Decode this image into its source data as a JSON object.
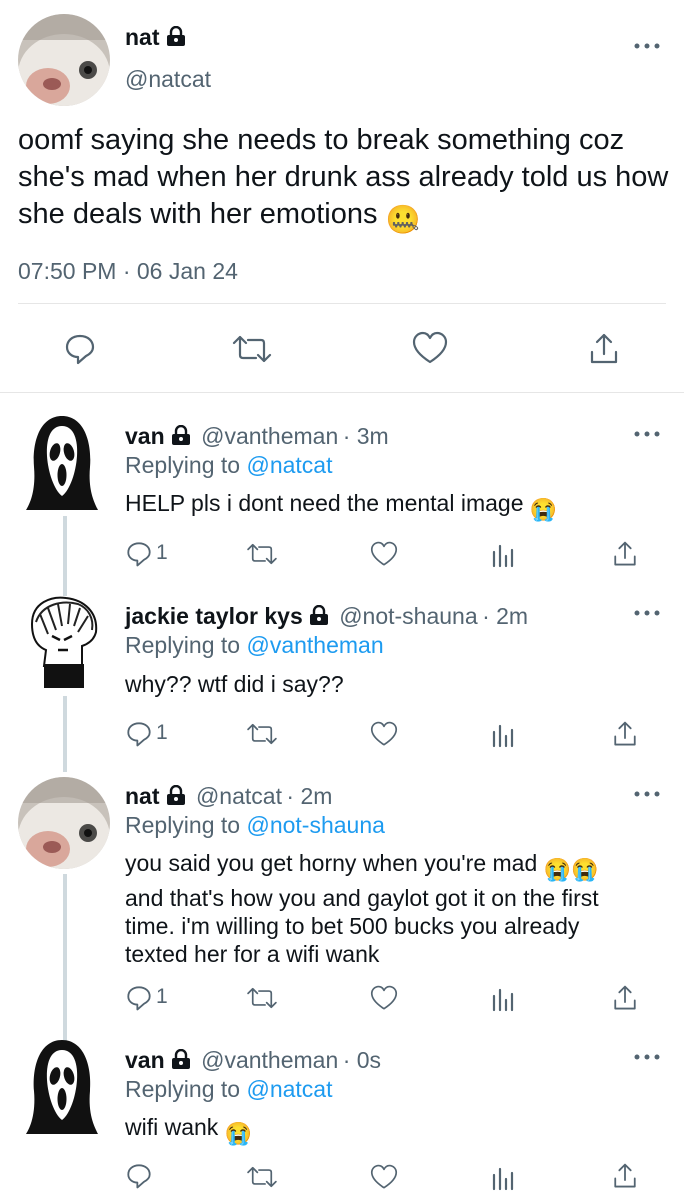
{
  "main_tweet": {
    "name": "nat",
    "handle": "@natcat",
    "text": "oomf saying she needs to break something coz she's mad when her drunk ass already told us how she deals with her emotions",
    "emoji": "🤐",
    "timestamp": "07:50 PM · 06 Jan 24"
  },
  "replies": [
    {
      "name": "van",
      "handle": "@vantheman",
      "time": "· 3m",
      "replying_prefix": "Replying to",
      "replying_to": "@natcat",
      "text": "HELP pls i dont need the mental image",
      "emoji": "😭",
      "reply_count": "1"
    },
    {
      "name": "jackie taylor kys",
      "handle": "@not-shauna",
      "time": "· 2m",
      "replying_prefix": "Replying to",
      "replying_to": "@vantheman",
      "text": "why?? wtf did i say??",
      "reply_count": "1"
    },
    {
      "name": "nat",
      "handle": "@natcat",
      "time": "· 2m",
      "replying_prefix": "Replying to",
      "replying_to": "@not-shauna",
      "line1": "you said you get horny when you're mad",
      "line1_emoji": "😭😭",
      "line2": "and that's how you and gaylot got it on the first",
      "line3": "time. i'm willing to bet 500 bucks you already",
      "line4": "texted her for a wifi wank",
      "reply_count": "1"
    },
    {
      "name": "van",
      "handle": "@vantheman",
      "time": "· 0s",
      "replying_prefix": "Replying to",
      "replying_to": "@natcat",
      "text": "wifi wank",
      "emoji": "😭"
    }
  ],
  "colors": {
    "link": "#1d9bf0",
    "secondary": "#536471",
    "primary": "#0f1419"
  }
}
